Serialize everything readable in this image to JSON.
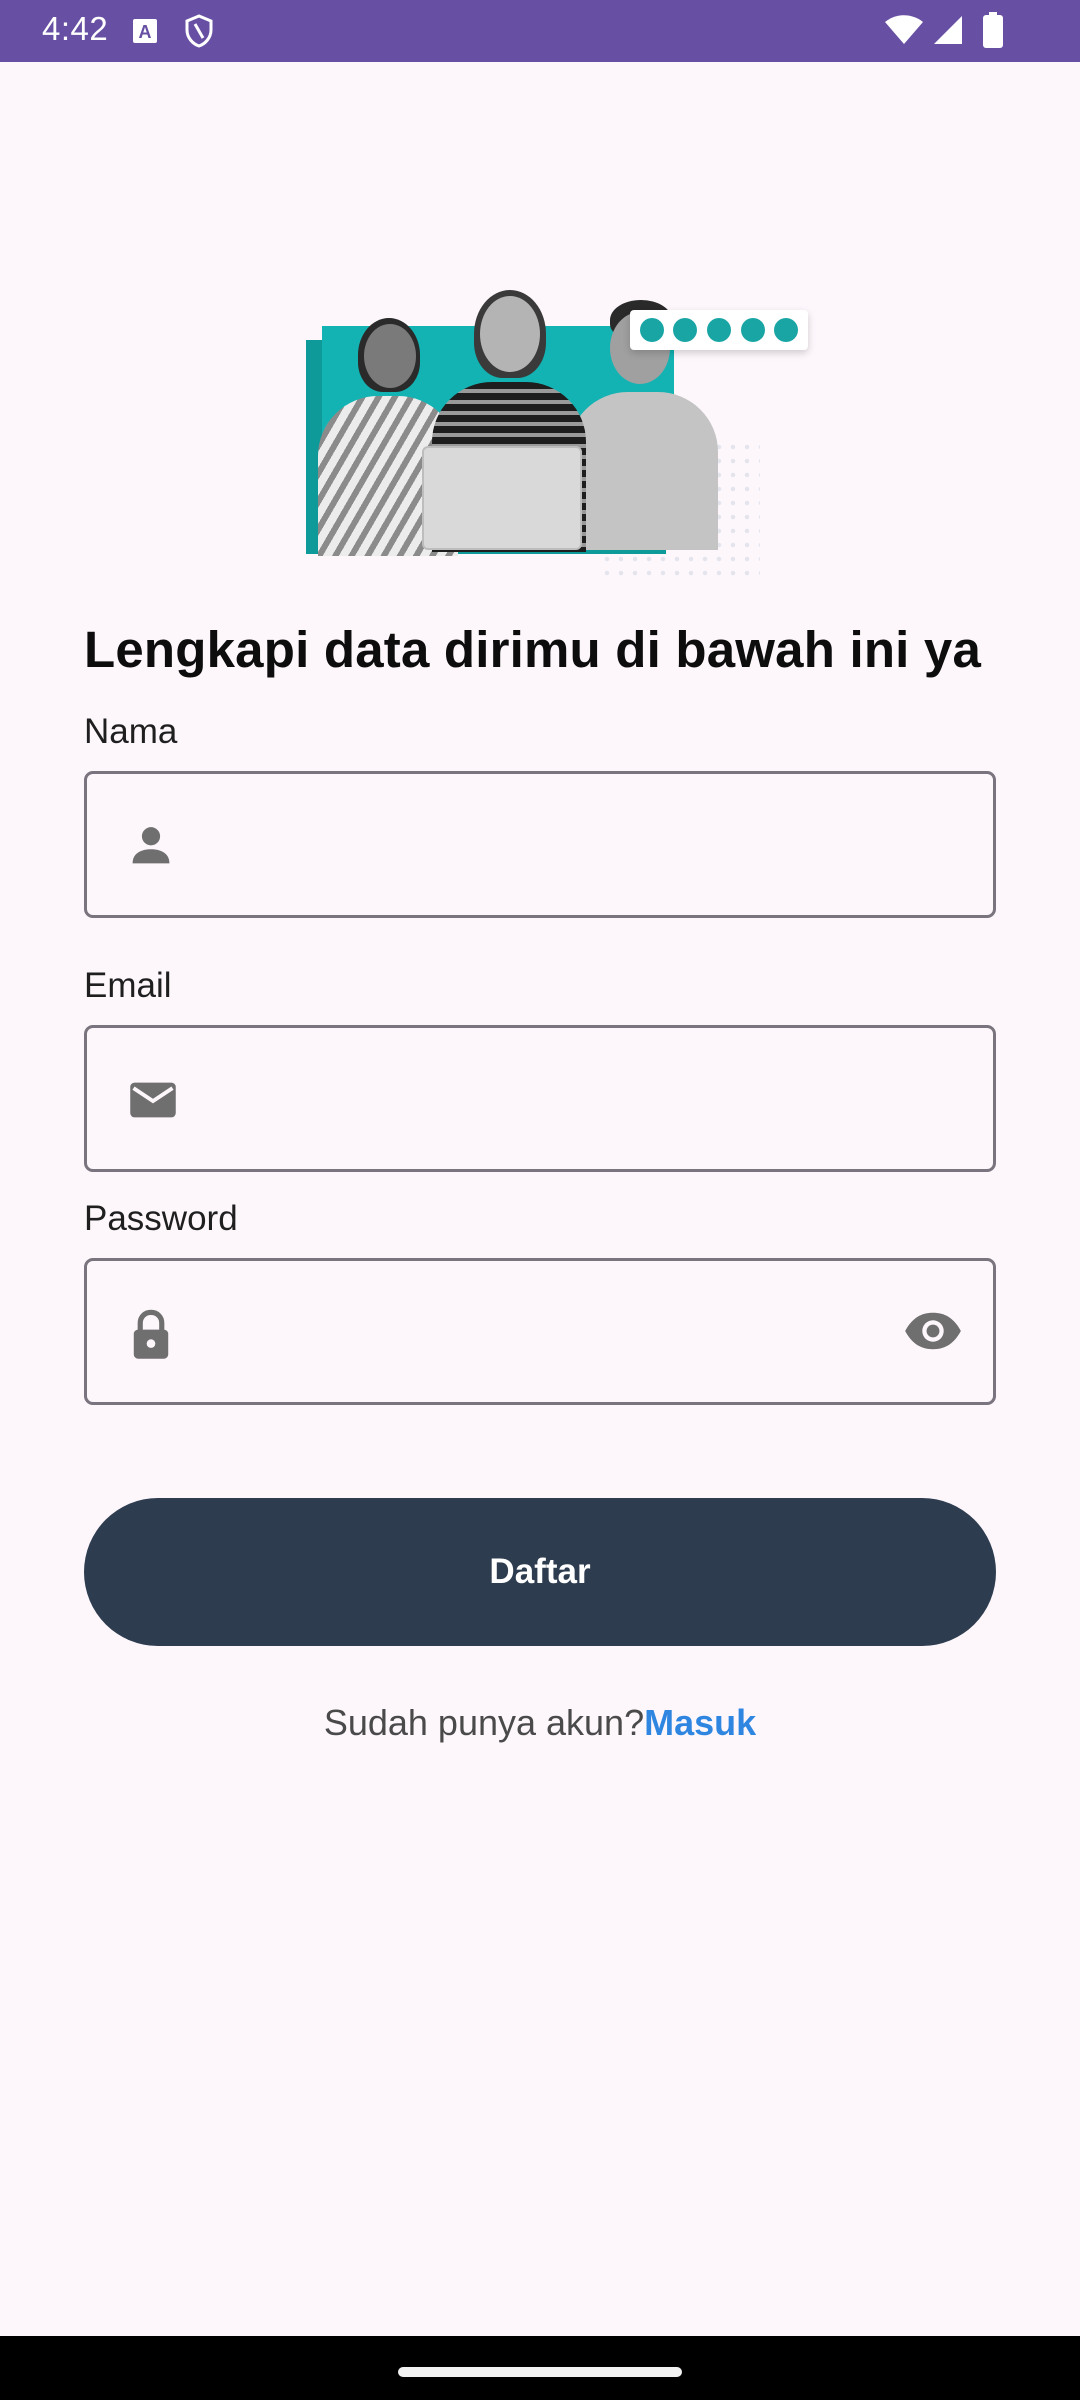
{
  "status_bar": {
    "time": "4:42",
    "icons": [
      "text-notification-icon",
      "shield-icon",
      "wifi-icon",
      "signal-icon",
      "battery-icon"
    ],
    "color": "#6750a4"
  },
  "hero": {
    "description_icons": [
      "code-icon",
      "android-icon",
      "ios-icon",
      "multi-platform-icon",
      "web-icon"
    ],
    "accent": "#14b3b3"
  },
  "form": {
    "title": "Lengkapi data dirimu di bawah ini ya",
    "name": {
      "label": "Nama",
      "value": "",
      "icon": "person-icon"
    },
    "email": {
      "label": "Email",
      "value": "",
      "icon": "email-icon"
    },
    "password": {
      "label": "Password",
      "value": "",
      "icon": "lock-icon",
      "toggle_icon": "eye-icon"
    },
    "submit_label": "Daftar",
    "login_prompt": "Sudah punya akun?",
    "login_link": "Masuk"
  },
  "colors": {
    "background": "#fdf7fc",
    "button": "#2d3c4f",
    "link": "#2f86e0",
    "outline": "#79747e"
  }
}
